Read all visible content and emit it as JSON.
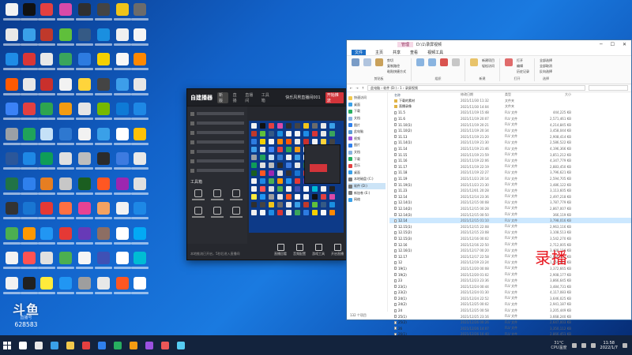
{
  "desktop": {
    "icon_colors": [
      "#f2f2f2",
      "#111111",
      "#e34040",
      "#d94aa8",
      "#2f2f2f",
      "#444444",
      "#f0c419",
      "#6b6b6b",
      "#e8e8e8",
      "#3aa0e8",
      "#c0392b",
      "#5fbf3b",
      "#355a85",
      "#1a8fe0",
      "#f0f0f0",
      "#f5f5f5",
      "#1f8ce6",
      "#d93636",
      "#e8e8e8",
      "#3aa55c",
      "#2d7be0",
      "#f5d000",
      "#f7f7f7",
      "#ff8800",
      "#ff5a00",
      "#e8e8e8",
      "#c9302c",
      "#f2f2f2",
      "#ffd43b",
      "#444444",
      "#3d9eea",
      "#e6e6e6",
      "#3b82f6",
      "#e34040",
      "#2ea44f",
      "#f39c12",
      "#e5e5e5",
      "#76b900",
      "#0e7ad6",
      "#1e88e5",
      "#9aa0a6",
      "#20a35a",
      "#c5e1f7",
      "#2e78d0",
      "#f2f2f2",
      "#3aa0e8",
      "#ffffff",
      "#ffc107",
      "#2b579a",
      "#1e88e5",
      "#0f9d58",
      "#e0e0e0",
      "#bdbdbd",
      "#2b2b2b",
      "#3d7be0",
      "#e8e8e8",
      "#217346",
      "#2f80ed",
      "#e67e22",
      "#c7c7c7",
      "#1b5e20",
      "#ff5722",
      "#9c27b0",
      "#e0e0e0",
      "#333333",
      "#1976d2",
      "#e53935",
      "#ff7043",
      "#e84393",
      "#f4a261",
      "#f2f2f2",
      "#1e88e5",
      "#4caf50",
      "#ff9800",
      "#2196f3",
      "#e53935",
      "#673ab7",
      "#8d6e63",
      "#ffffff",
      "#03a9f4",
      "#f2f2f2",
      "#ff5252",
      "#e0e0e0",
      "#4caf50",
      "#f5f5f5",
      "#3f51b5",
      "#ffffff",
      "#00bcd4",
      "#f2f2f2",
      "#212121",
      "#ffeb3b",
      "#2196f3",
      "#9e9e9e",
      "#e8e8e8",
      "#ff5722",
      "#ffffff"
    ]
  },
  "stream": {
    "logo_text": "斗鱼",
    "sub_text": "直播号",
    "room_number": "628583"
  },
  "recorder": {
    "logo": "自建播器",
    "version": "新版",
    "tabs": [
      "直播",
      "直播间",
      "工具箱"
    ],
    "preview_title": "快乐风男直播间001",
    "alert": "开始推流",
    "tools_title": "工具箱",
    "buttons": [
      "直播回看",
      "音频配置",
      "游戏工具",
      "开启直播"
    ],
    "footer": "本地推流已开启，5秒后进入直播间"
  },
  "explorer": {
    "manage_tab": "管理",
    "window_title": "D:\\1\\录屏视频",
    "menu": [
      "文件",
      "主页",
      "共享",
      "查看",
      "视频工具"
    ],
    "ribbon": {
      "small_items": [
        "剪切",
        "复制路径",
        "粘贴快捷方式"
      ],
      "groups": [
        "剪贴板",
        "组织",
        "新建",
        "打开",
        "选择"
      ],
      "select_items": [
        "全部选择",
        "全部取消",
        "反向选择"
      ],
      "new_items": [
        "新建项目",
        "轻松访问"
      ],
      "open_items": [
        "打开",
        "编辑",
        "历史记录"
      ]
    },
    "address": "此电脑 › 软件 (D:) › 1 › 录屏视频",
    "nav": [
      "快速访问",
      "桌面",
      "下载",
      "文档",
      "图片",
      "此电脑",
      "视频",
      "图片",
      "文档",
      "下载",
      "音乐",
      "桌面",
      "本地磁盘 (C:)",
      "软件 (D:)",
      "新加卷 (E:)",
      "网络"
    ],
    "headers": [
      "名称",
      "修改日期",
      "类型",
      "大小"
    ],
    "files": [
      {
        "name": "下载的素材",
        "date": "2021/11/30 11:32",
        "type": "文件夹",
        "size": ""
      },
      {
        "name": "直播录像",
        "date": "2021/11/30 14:04",
        "type": "文件夹",
        "size": ""
      },
      {
        "name": "11.5",
        "date": "2021/11/19 15:48",
        "type": "FLV 文件",
        "size": "444,225 KB"
      },
      {
        "name": "11.6",
        "date": "2021/11/19 20:07",
        "type": "FLV 文件",
        "size": "2,571,461 KB"
      },
      {
        "name": "11.10(1)",
        "date": "2021/11/19 20:21",
        "type": "FLV 文件",
        "size": "4,214,845 KB"
      },
      {
        "name": "11.10(2)",
        "date": "2021/11/19 20:34",
        "type": "FLV 文件",
        "size": "3,458,044 KB"
      },
      {
        "name": "11.13",
        "date": "2021/11/19 21:20",
        "type": "FLV 文件",
        "size": "2,908,414 KB"
      },
      {
        "name": "11.14(1)",
        "date": "2021/11/19 21:30",
        "type": "FLV 文件",
        "size": "2,586,522 KB"
      },
      {
        "name": "11.14",
        "date": "2021/11/19 21:46",
        "type": "FLV 文件",
        "size": "4,196,366 KB"
      },
      {
        "name": "11.15",
        "date": "2021/11/19 21:59",
        "type": "FLV 文件",
        "size": "3,851,212 KB"
      },
      {
        "name": "11.16",
        "date": "2021/11/19 22:06",
        "type": "FLV 文件",
        "size": "4,347,779 KB"
      },
      {
        "name": "11.17",
        "date": "2021/11/19 22:19",
        "type": "FLV 文件",
        "size": "2,883,450 KB"
      },
      {
        "name": "11.18",
        "date": "2021/11/19 22:27",
        "type": "FLV 文件",
        "size": "3,796,621 KB"
      },
      {
        "name": "11.19",
        "date": "2021/11/23 20:14",
        "type": "FLV 文件",
        "size": "2,594,705 KB"
      },
      {
        "name": "11.19(1)",
        "date": "2021/11/23 21:30",
        "type": "FLV 文件",
        "size": "3,486,122 KB"
      },
      {
        "name": "11.23",
        "date": "2021/12/01 20:28",
        "type": "FLV 文件",
        "size": "3,113,605 KB"
      },
      {
        "name": "12.14",
        "date": "2021/12/14 23:36",
        "type": "FLV 文件",
        "size": "2,497,218 KB"
      },
      {
        "name": "12.14(1)",
        "date": "2021/12/15 00:08",
        "type": "FLV 文件",
        "size": "3,787,779 KB"
      },
      {
        "name": "12.14(2)",
        "date": "2021/12/15 00:28",
        "type": "FLV 文件",
        "size": "2,867,007 KB"
      },
      {
        "name": "12.14(3)",
        "date": "2021/12/15 00:50",
        "type": "FLV 文件",
        "size": "366,119 KB"
      },
      {
        "name": "12.14",
        "date": "2021/12/15 01:10",
        "type": "FLV 文件",
        "size": "3,798,016 KB"
      },
      {
        "name": "12.15(1)",
        "date": "2021/12/15 22:08",
        "type": "FLV 文件",
        "size": "2,963,116 KB"
      },
      {
        "name": "12.15(2)",
        "date": "2021/12/15 23:08",
        "type": "FLV 文件",
        "size": "3,108,513 KB"
      },
      {
        "name": "12.15(3)",
        "date": "2021/12/16 00:02",
        "type": "FLV 文件",
        "size": "3,542,270 KB"
      },
      {
        "name": "12.16",
        "date": "2021/12/16 22:50",
        "type": "FLV 文件",
        "size": "2,712,005 KB"
      },
      {
        "name": "12.16(1)",
        "date": "2021/12/17 00:20",
        "type": "FLV 文件",
        "size": "3,408,116 KB"
      },
      {
        "name": "12.17",
        "date": "2021/12/17 22:58",
        "type": "FLV 文件",
        "size": "2,846,551 KB"
      },
      {
        "name": "12",
        "date": "2021/12/19 23:24",
        "type": "FLV 文件",
        "size": "1,050,614 KB"
      },
      {
        "name": "19(1)",
        "date": "2021/12/20 00:08",
        "type": "FLV 文件",
        "size": "3,372,665 KB"
      },
      {
        "name": "19(2)",
        "date": "2021/12/20 01:02",
        "type": "FLV 文件",
        "size": "2,908,177 KB"
      },
      {
        "name": "23",
        "date": "2021/12/23 23:36",
        "type": "FLV 文件",
        "size": "3,866,645 KB"
      },
      {
        "name": "23(1)",
        "date": "2021/12/24 00:44",
        "type": "FLV 文件",
        "size": "3,484,731 KB"
      },
      {
        "name": "23(2)",
        "date": "2021/12/24 01:30",
        "type": "FLV 文件",
        "size": "4,117,083 KB"
      },
      {
        "name": "24(1)",
        "date": "2021/12/24 22:52",
        "type": "FLV 文件",
        "size": "3,646,025 KB"
      },
      {
        "name": "24(2)",
        "date": "2021/12/25 00:02",
        "type": "FLV 文件",
        "size": "2,941,187 KB"
      },
      {
        "name": "24",
        "date": "2021/12/25 00:58",
        "type": "FLV 文件",
        "size": "3,205,449 KB"
      },
      {
        "name": "25(1)",
        "date": "2021/12/25 23:16",
        "type": "FLV 文件",
        "size": "3,668,240 KB"
      },
      {
        "name": "25(2)",
        "date": "2021/12/26 00:26",
        "type": "FLV 文件",
        "size": "2,647,003 KB"
      },
      {
        "name": "26",
        "date": "2021/12/26 14:07",
        "type": "FLV 文件",
        "size": "3,350,112 KB"
      },
      {
        "name": "26(1)",
        "date": "2021/12/26 16:40",
        "type": "FLV 文件",
        "size": "2,866,451 KB"
      },
      {
        "name": "25",
        "date": "2021/12/27 01:44",
        "type": "FLV 文件",
        "size": "3,094,780 KB"
      }
    ],
    "status": "132 个项目",
    "overlay_label": "录播"
  },
  "taskbar": {
    "icon_colors": [
      "#ffffff",
      "#e8e8e8",
      "#3aa0e8",
      "#f2c94c",
      "#e34040",
      "#2f80ed",
      "#27ae60",
      "#f39c12",
      "#9b51e0",
      "#eb5757",
      "#56ccf2"
    ],
    "cpu_temp": "31°C",
    "cpu_label": "CPU温度",
    "time": "11:58",
    "date": "2022/1/7"
  }
}
